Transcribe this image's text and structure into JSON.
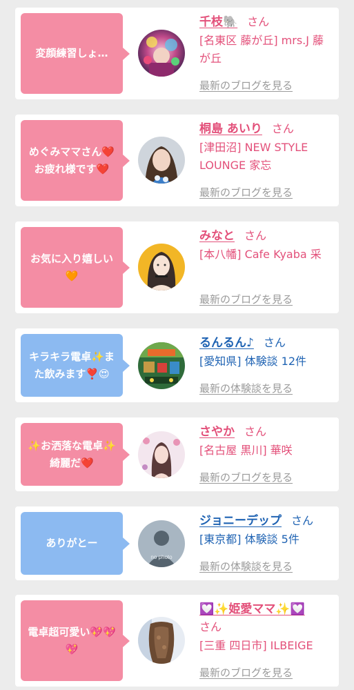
{
  "colors": {
    "pink": "#f48da4",
    "blue": "#8cbaf1",
    "pink_text": "#e3507a",
    "blue_text": "#1f63b3",
    "link_gray": "#9a9a9a",
    "background": "#ececec"
  },
  "cards": [
    {
      "bubble": "変顔練習しょ…",
      "bubble_color": "pink",
      "avatar": "colorful-portrait",
      "name": "千枝🐘",
      "san": "さん",
      "shop": "[名東区 藤が丘] mrs.J 藤が丘",
      "link": "最新のブログを見る"
    },
    {
      "bubble": "めぐみママさん❤️ お疲れ様です❤️",
      "bubble_color": "pink",
      "avatar": "woman-portrait",
      "name": "桐島 あいり",
      "san": "さん",
      "shop": "[津田沼] NEW STYLE LOUNGE 家忘",
      "link": "最新のブログを見る"
    },
    {
      "bubble": "お気に入り嬉しい🧡",
      "bubble_color": "pink",
      "avatar": "illustration-portrait",
      "name": "みなと",
      "san": "さん",
      "shop": "[本八幡] Cafe Kyaba 采",
      "link": "最新のブログを見る"
    },
    {
      "bubble": "キラキラ電卓✨また飲みます❣️😍",
      "bubble_color": "blue",
      "avatar": "game-screen",
      "name": "るんるん♪",
      "san": "さん",
      "shop": "[愛知県] 体験談 12件",
      "link": "最新の体験談を見る"
    },
    {
      "bubble": "✨お洒落な電卓✨綺麗だ❤️",
      "bubble_color": "pink",
      "avatar": "floral-portrait",
      "name": "さやか",
      "san": "さん",
      "shop": "[名古屋 黒川] 華咲",
      "link": "最新のブログを見る"
    },
    {
      "bubble": "ありがとー",
      "bubble_color": "blue",
      "avatar": "no-photo",
      "avatar_text": "no photo",
      "name": "ジョニーデップ",
      "san": "さん",
      "shop": "[東京都] 体験談 5件",
      "link": "最新の体験談を見る"
    },
    {
      "bubble": "電卓超可愛い💖💖💖",
      "bubble_color": "pink",
      "avatar": "hair-back",
      "name": "💟✨姫愛ママ✨💟",
      "san": "さん",
      "shop": "[三重 四日市] ILBEIGE",
      "link": "最新のブログを見る"
    }
  ]
}
